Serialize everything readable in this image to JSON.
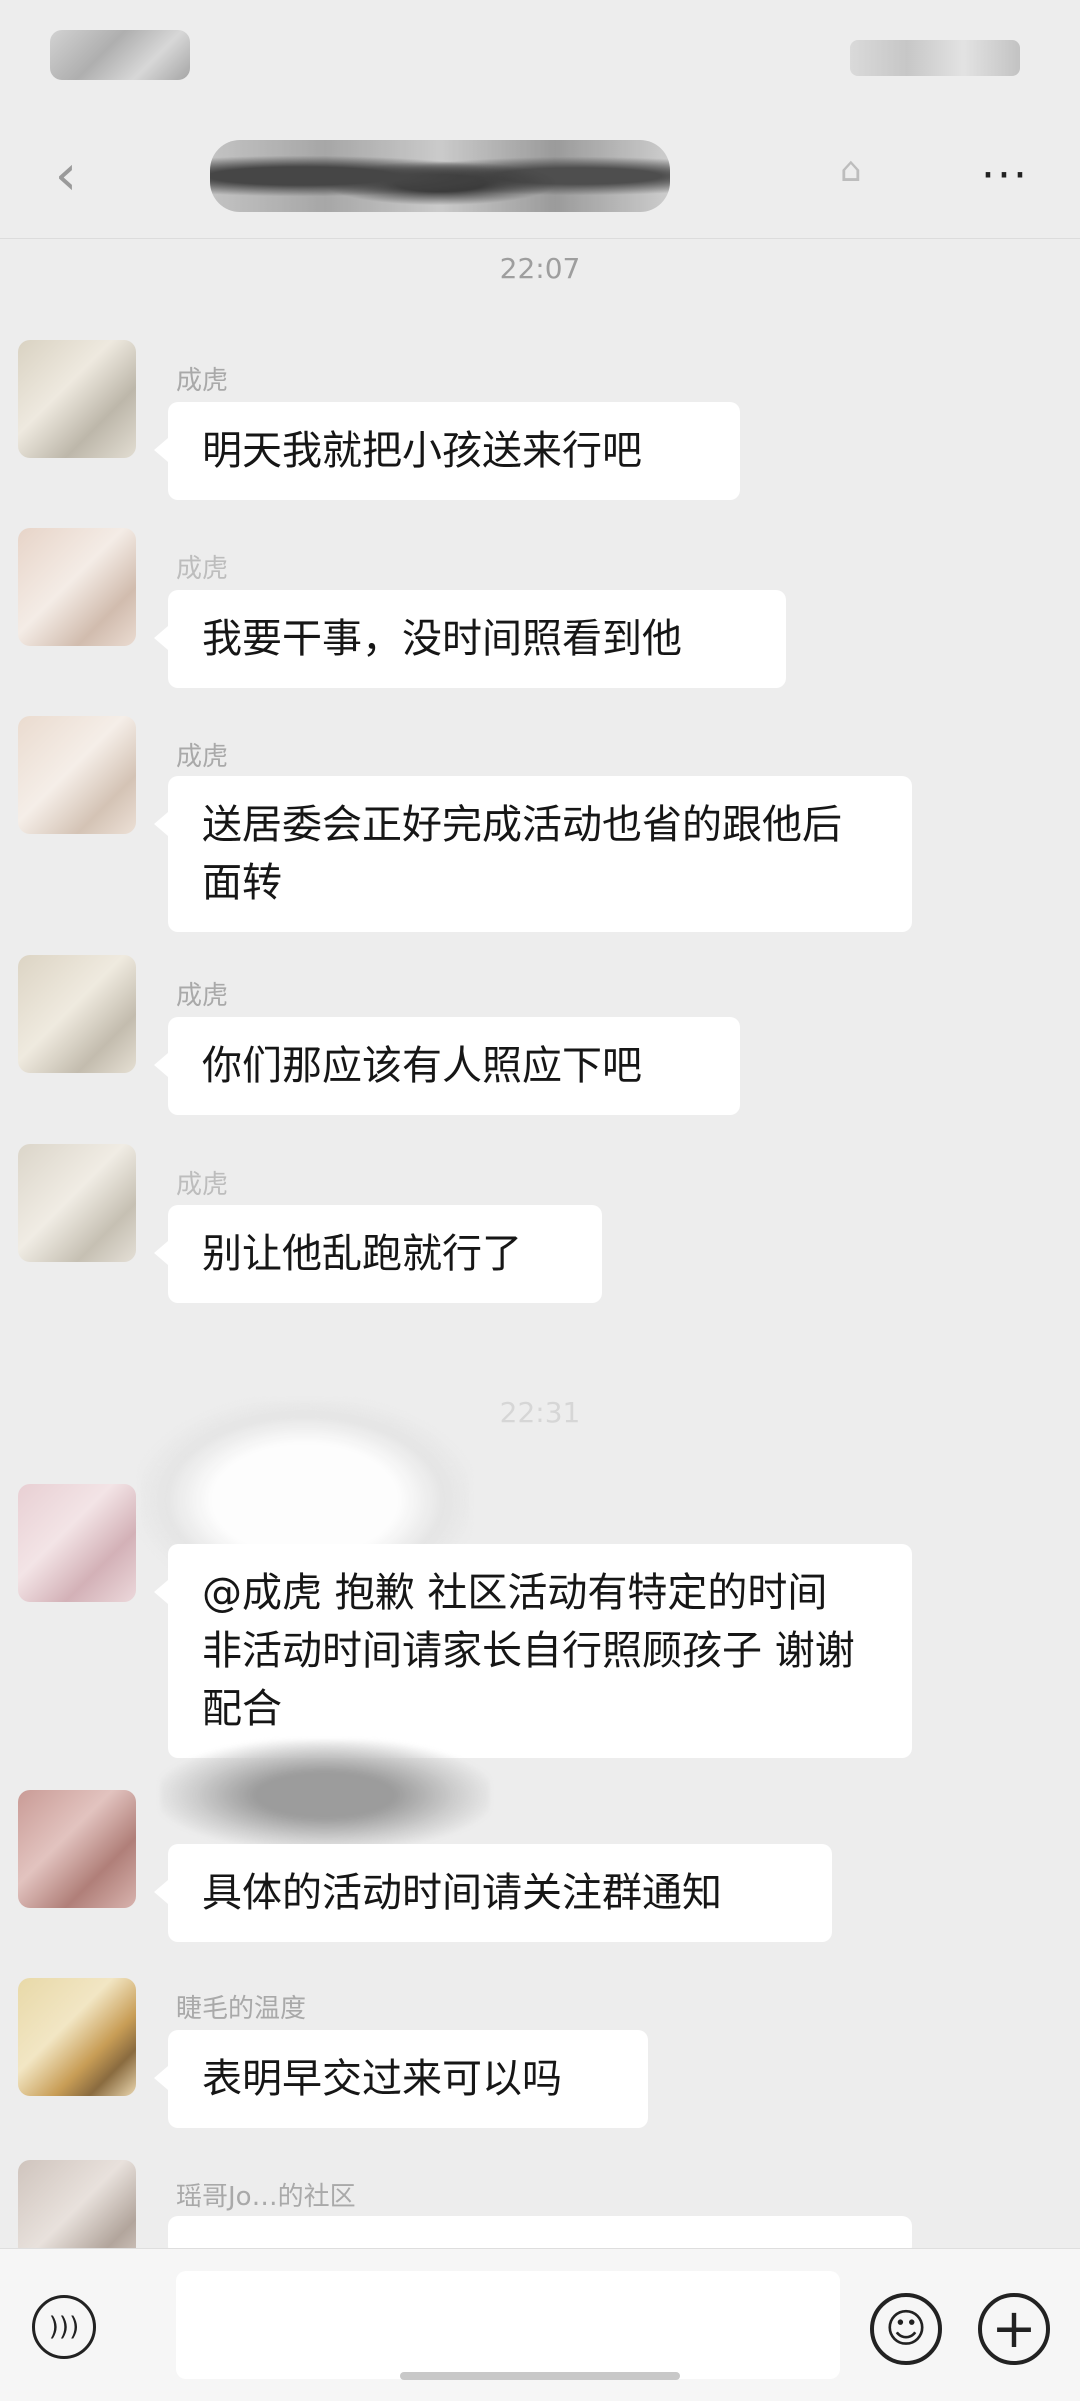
{
  "header": {
    "back_icon": "chevron-left-icon",
    "more_label": "···"
  },
  "timestamps": [
    "22:07",
    "22:31"
  ],
  "messages": [
    {
      "sender": "成虎",
      "text": "明天我就把小孩送来行吧"
    },
    {
      "sender": "成虎",
      "text": "我要干事，没时间照看到他"
    },
    {
      "sender": "成虎",
      "text": "送居委会正好完成活动也省的跟他后面转"
    },
    {
      "sender": "成虎",
      "text": "你们那应该有人照应下吧"
    },
    {
      "sender": "成虎",
      "text": "别让他乱跑就行了"
    },
    {
      "sender": "",
      "text": "@成虎  抱歉 社区活动有特定的时间 非活动时间请家长自行照顾孩子 谢谢配合"
    },
    {
      "sender": "",
      "text": "具体的活动时间请关注群通知"
    },
    {
      "sender": "睫毛的温度",
      "text": "表明早交过来可以吗"
    },
    {
      "sender": "瑶哥Jo…的社区",
      "text": ""
    }
  ],
  "bottom_bar": {
    "voice_icon": "voice-icon",
    "emoji_icon": "emoji-icon",
    "plus_icon": "plus-icon"
  }
}
